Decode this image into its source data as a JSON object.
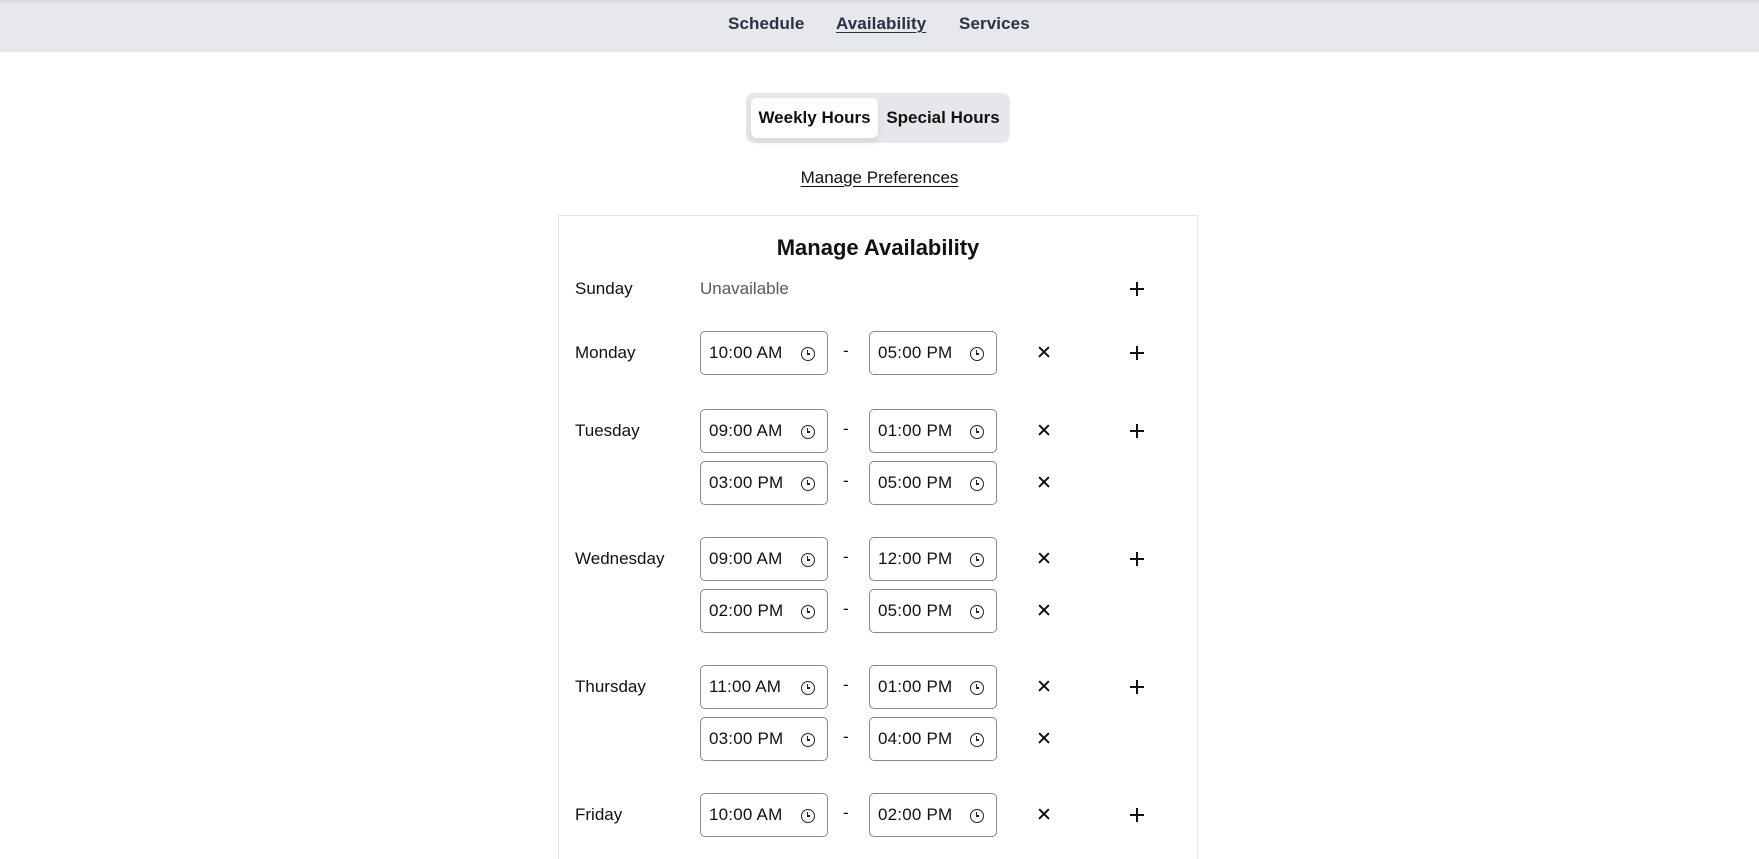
{
  "nav": {
    "items": [
      {
        "label": "Schedule",
        "active": false
      },
      {
        "label": "Availability",
        "active": true
      },
      {
        "label": "Services",
        "active": false
      }
    ]
  },
  "tabs": {
    "weekly": "Weekly Hours",
    "special": "Special Hours",
    "active": "weekly"
  },
  "preferences_link": "Manage Preferences",
  "card": {
    "title": "Manage Availability",
    "days": [
      {
        "day": "Sunday",
        "status": "Unavailable",
        "slots": []
      },
      {
        "day": "Monday",
        "slots": [
          {
            "start": "10:00 AM",
            "end": "05:00 PM"
          }
        ]
      },
      {
        "day": "Tuesday",
        "slots": [
          {
            "start": "09:00 AM",
            "end": "01:00 PM"
          },
          {
            "start": "03:00 PM",
            "end": "05:00 PM"
          }
        ]
      },
      {
        "day": "Wednesday",
        "slots": [
          {
            "start": "09:00 AM",
            "end": "12:00 PM"
          },
          {
            "start": "02:00 PM",
            "end": "05:00 PM"
          }
        ]
      },
      {
        "day": "Thursday",
        "slots": [
          {
            "start": "11:00 AM",
            "end": "01:00 PM"
          },
          {
            "start": "03:00 PM",
            "end": "04:00 PM"
          }
        ]
      },
      {
        "day": "Friday",
        "slots": [
          {
            "start": "10:00 AM",
            "end": "02:00 PM"
          }
        ]
      }
    ],
    "separator": "-"
  },
  "icons": {
    "clock": "clock-icon",
    "remove": "close-icon",
    "add": "plus-icon"
  }
}
